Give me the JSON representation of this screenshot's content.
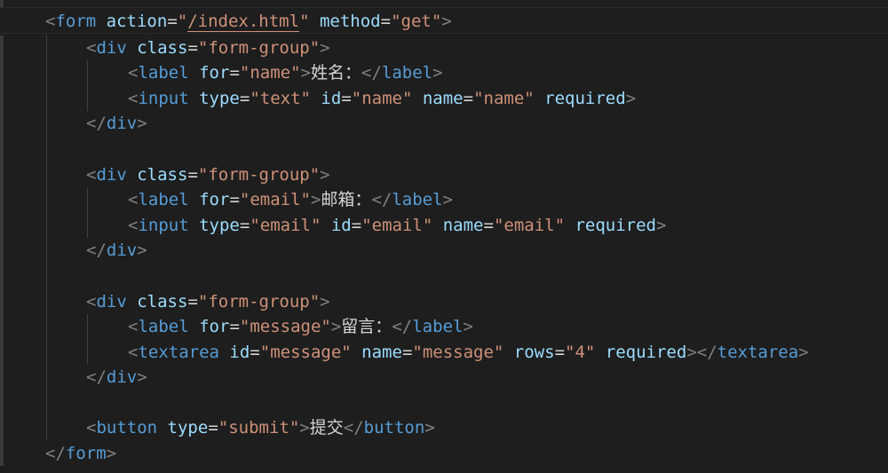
{
  "editor": {
    "colors": {
      "background": "#1e1e1e",
      "tag_bracket": "#808080",
      "tag_name": "#569cd6",
      "attribute": "#9cdcfe",
      "string": "#ce9178",
      "text": "#d4d4d4"
    },
    "lines": [
      {
        "form_open": {
          "lt": "<",
          "tag": "form",
          "attr1": "action",
          "eq1": "=",
          "q1a": "\"",
          "val1": "/index.html",
          "q1b": "\"",
          "attr2": "method",
          "eq2": "=",
          "val2": "\"get\"",
          "gt": ">"
        }
      },
      {
        "div1_open": {
          "lt": "<",
          "tag": "div",
          "attr": "class",
          "eq": "=",
          "val": "\"form-group\"",
          "gt": ">"
        },
        "label1": {
          "lt": "<",
          "tag": "label",
          "attr": "for",
          "eq": "=",
          "val": "\"name\"",
          "gt": ">",
          "text": "姓名：",
          "close_lt": "</",
          "close_tag": "label",
          "close_gt": ">"
        },
        "input1": {
          "lt": "<",
          "tag": "input",
          "attr1": "type",
          "eq1": "=",
          "val1": "\"text\"",
          "attr2": "id",
          "eq2": "=",
          "val2": "\"name\"",
          "attr3": "name",
          "eq3": "=",
          "val3": "\"name\"",
          "attr4": "required",
          "gt": ">"
        },
        "div1_close": {
          "lt": "</",
          "tag": "div",
          "gt": ">"
        }
      },
      {
        "div2_open": {
          "lt": "<",
          "tag": "div",
          "attr": "class",
          "eq": "=",
          "val": "\"form-group\"",
          "gt": ">"
        },
        "label2": {
          "lt": "<",
          "tag": "label",
          "attr": "for",
          "eq": "=",
          "val": "\"email\"",
          "gt": ">",
          "text": "邮箱：",
          "close_lt": "</",
          "close_tag": "label",
          "close_gt": ">"
        },
        "input2": {
          "lt": "<",
          "tag": "input",
          "attr1": "type",
          "eq1": "=",
          "val1": "\"email\"",
          "attr2": "id",
          "eq2": "=",
          "val2": "\"email\"",
          "attr3": "name",
          "eq3": "=",
          "val3": "\"email\"",
          "attr4": "required",
          "gt": ">"
        },
        "div2_close": {
          "lt": "</",
          "tag": "div",
          "gt": ">"
        }
      },
      {
        "div3_open": {
          "lt": "<",
          "tag": "div",
          "attr": "class",
          "eq": "=",
          "val": "\"form-group\"",
          "gt": ">"
        },
        "label3": {
          "lt": "<",
          "tag": "label",
          "attr": "for",
          "eq": "=",
          "val": "\"message\"",
          "gt": ">",
          "text": "留言：",
          "close_lt": "</",
          "close_tag": "label",
          "close_gt": ">"
        },
        "textarea": {
          "lt": "<",
          "tag": "textarea",
          "attr1": "id",
          "eq1": "=",
          "val1": "\"message\"",
          "attr2": "name",
          "eq2": "=",
          "val2": "\"message\"",
          "attr3": "rows",
          "eq3": "=",
          "val3": "\"4\"",
          "attr4": "required",
          "gt": ">",
          "close_lt": "</",
          "close_tag": "textarea",
          "close_gt": ">"
        },
        "div3_close": {
          "lt": "</",
          "tag": "div",
          "gt": ">"
        }
      },
      {
        "button": {
          "lt": "<",
          "tag": "button",
          "attr": "type",
          "eq": "=",
          "val": "\"submit\"",
          "gt": ">",
          "text": "提交",
          "close_lt": "</",
          "close_tag": "button",
          "close_gt": ">"
        },
        "form_close": {
          "lt": "</",
          "tag": "form",
          "gt": ">"
        }
      }
    ]
  }
}
